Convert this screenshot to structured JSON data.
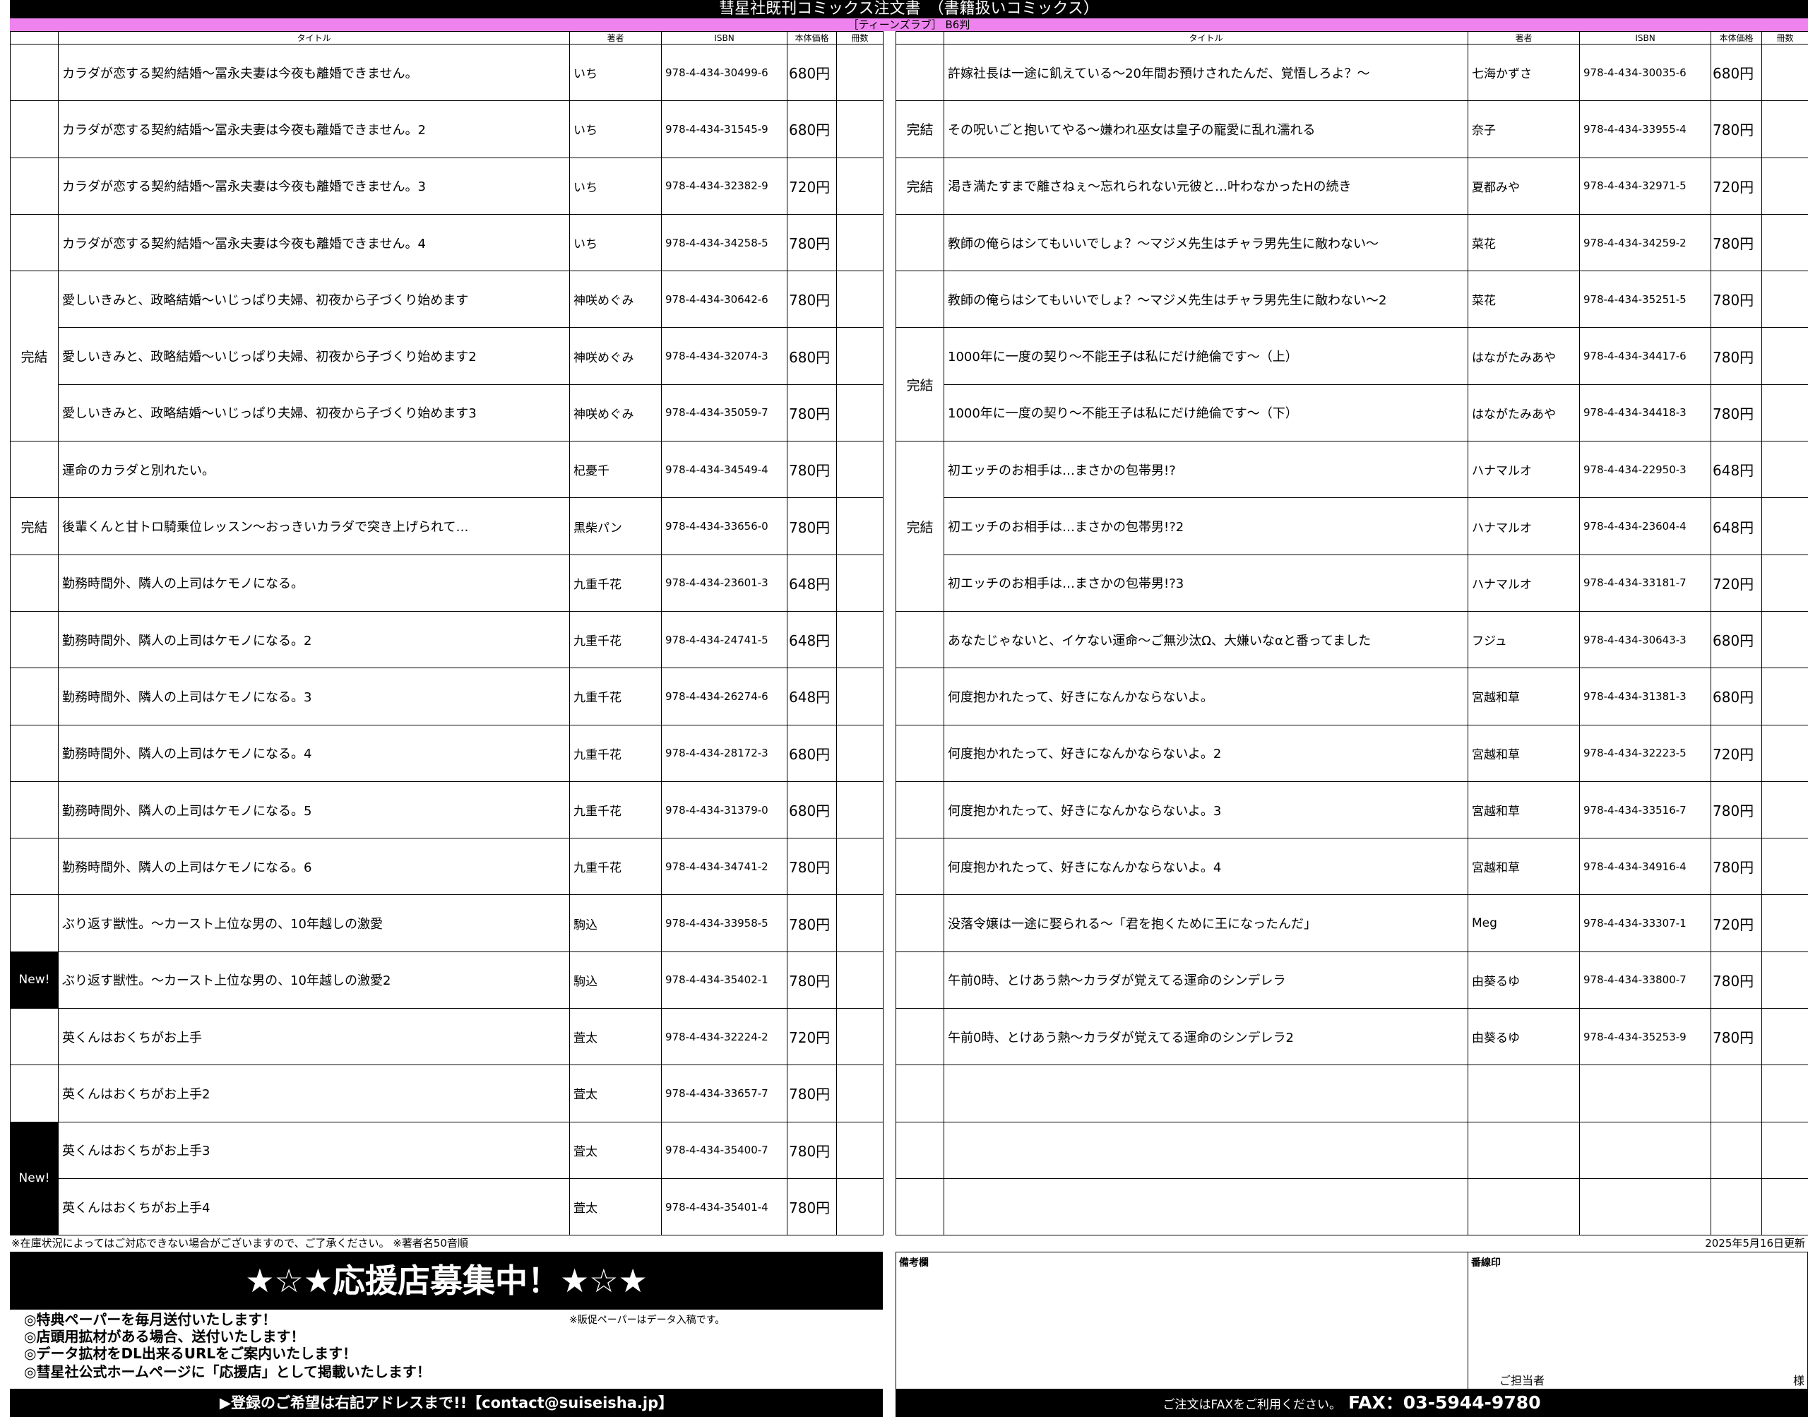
{
  "header": {
    "title": "彗星社既刊コミックス注文書　（書籍扱いコミックス）",
    "subtitle": "［ティーンズラブ］ B6判"
  },
  "table_headers": {
    "status": "",
    "title": "タイトル",
    "author": "著者",
    "isbn": "ISBN",
    "price": "本体価格",
    "qty": "冊数"
  },
  "left_rows": [
    {
      "status": "",
      "title": "カラダが恋する契約結婚～冨永夫妻は今夜も離婚できません。",
      "author": "いち",
      "isbn": "978-4-434-30499-6",
      "price": "680円"
    },
    {
      "status": "",
      "title": "カラダが恋する契約結婚～冨永夫妻は今夜も離婚できません。2",
      "author": "いち",
      "isbn": "978-4-434-31545-9",
      "price": "680円"
    },
    {
      "status": "",
      "title": "カラダが恋する契約結婚～冨永夫妻は今夜も離婚できません。3",
      "author": "いち",
      "isbn": "978-4-434-32382-9",
      "price": "720円"
    },
    {
      "status": "",
      "title": "カラダが恋する契約結婚～冨永夫妻は今夜も離婚できません。4",
      "author": "いち",
      "isbn": "978-4-434-34258-5",
      "price": "780円"
    },
    {
      "status": "完結",
      "status_rows": 3,
      "title": "愛しいきみと、政略結婚～いじっぱり夫婦、初夜から子づくり始めます",
      "author": "神咲めぐみ",
      "isbn": "978-4-434-30642-6",
      "price": "780円"
    },
    {
      "title": "愛しいきみと、政略結婚～いじっぱり夫婦、初夜から子づくり始めます2",
      "author": "神咲めぐみ",
      "isbn": "978-4-434-32074-3",
      "price": "680円"
    },
    {
      "title": "愛しいきみと、政略結婚～いじっぱり夫婦、初夜から子づくり始めます3",
      "author": "神咲めぐみ",
      "isbn": "978-4-434-35059-7",
      "price": "780円"
    },
    {
      "status": "",
      "title": "運命のカラダと別れたい。",
      "author": "杞憂千",
      "isbn": "978-4-434-34549-4",
      "price": "780円"
    },
    {
      "status": "完結",
      "title": "後輩くんと甘トロ騎乗位レッスン～おっきいカラダで突き上げられて…",
      "author": "黒柴パン",
      "isbn": "978-4-434-33656-0",
      "price": "780円"
    },
    {
      "status": "",
      "title": "勤務時間外、隣人の上司はケモノになる。",
      "author": "九重千花",
      "isbn": "978-4-434-23601-3",
      "price": "648円"
    },
    {
      "status": "",
      "title": "勤務時間外、隣人の上司はケモノになる。2",
      "author": "九重千花",
      "isbn": "978-4-434-24741-5",
      "price": "648円"
    },
    {
      "status": "",
      "title": "勤務時間外、隣人の上司はケモノになる。3",
      "author": "九重千花",
      "isbn": "978-4-434-26274-6",
      "price": "648円"
    },
    {
      "status": "",
      "title": "勤務時間外、隣人の上司はケモノになる。4",
      "author": "九重千花",
      "isbn": "978-4-434-28172-3",
      "price": "680円"
    },
    {
      "status": "",
      "title": "勤務時間外、隣人の上司はケモノになる。5",
      "author": "九重千花",
      "isbn": "978-4-434-31379-0",
      "price": "680円"
    },
    {
      "status": "",
      "title": "勤務時間外、隣人の上司はケモノになる。6",
      "author": "九重千花",
      "isbn": "978-4-434-34741-2",
      "price": "780円"
    },
    {
      "status": "",
      "title": "ぶり返す獣性。～カースト上位な男の、10年越しの激愛",
      "author": "駒込",
      "isbn": "978-4-434-33958-5",
      "price": "780円"
    },
    {
      "status": "New!",
      "status_new": true,
      "title": "ぶり返す獣性。～カースト上位な男の、10年越しの激愛2",
      "author": "駒込",
      "isbn": "978-4-434-35402-1",
      "price": "780円"
    },
    {
      "status": "",
      "title": "英くんはおくちがお上手",
      "author": "萓太",
      "isbn": "978-4-434-32224-2",
      "price": "720円"
    },
    {
      "status": "",
      "title": "英くんはおくちがお上手2",
      "author": "萓太",
      "isbn": "978-4-434-33657-7",
      "price": "780円"
    },
    {
      "status": "New!",
      "status_new": true,
      "status_rows": 2,
      "title": "英くんはおくちがお上手3",
      "author": "萓太",
      "isbn": "978-4-434-35400-7",
      "price": "780円"
    },
    {
      "title": "英くんはおくちがお上手4",
      "author": "萓太",
      "isbn": "978-4-434-35401-4",
      "price": "780円"
    }
  ],
  "right_rows": [
    {
      "status": "",
      "title": "許嫁社長は一途に飢えている～20年間お預けされたんだ、覚悟しろよ？～",
      "author": "七海かずさ",
      "isbn": "978-4-434-30035-6",
      "price": "680円"
    },
    {
      "status": "完結",
      "title": "その呪いごと抱いてやる～嫌われ巫女は皇子の寵愛に乱れ濡れる",
      "author": "奈子",
      "isbn": "978-4-434-33955-4",
      "price": "780円"
    },
    {
      "status": "完結",
      "title": "渇き満たすまで離さねぇ～忘れられない元彼と…叶わなかったHの続き",
      "author": "夏都みや",
      "isbn": "978-4-434-32971-5",
      "price": "720円"
    },
    {
      "status": "",
      "title": "教師の俺らはシてもいいでしょ？～マジメ先生はチャラ男先生に敵わない～",
      "author": "菜花",
      "isbn": "978-4-434-34259-2",
      "price": "780円"
    },
    {
      "status": "",
      "title": "教師の俺らはシてもいいでしょ？～マジメ先生はチャラ男先生に敵わない～2",
      "author": "菜花",
      "isbn": "978-4-434-35251-5",
      "price": "780円"
    },
    {
      "status": "完結",
      "status_rows": 2,
      "title": "1000年に一度の契り～不能王子は私にだけ絶倫です～（上）",
      "author": "はながたみあや",
      "isbn": "978-4-434-34417-6",
      "price": "780円"
    },
    {
      "title": "1000年に一度の契り～不能王子は私にだけ絶倫です～（下）",
      "author": "はながたみあや",
      "isbn": "978-4-434-34418-3",
      "price": "780円"
    },
    {
      "status": "完結",
      "status_rows": 3,
      "title": "初エッチのお相手は…まさかの包帯男!?",
      "author": "ハナマルオ",
      "isbn": "978-4-434-22950-3",
      "price": "648円"
    },
    {
      "title": "初エッチのお相手は…まさかの包帯男!?2",
      "author": "ハナマルオ",
      "isbn": "978-4-434-23604-4",
      "price": "648円"
    },
    {
      "title": "初エッチのお相手は…まさかの包帯男!?3",
      "author": "ハナマルオ",
      "isbn": "978-4-434-33181-7",
      "price": "720円"
    },
    {
      "status": "",
      "title": "あなたじゃないと、イケない運命～ご無沙汰Ω、大嫌いなαと番ってました",
      "author": "フジュ",
      "isbn": "978-4-434-30643-3",
      "price": "680円"
    },
    {
      "status": "",
      "title": "何度抱かれたって、好きになんかならないよ。",
      "author": "宮越和草",
      "isbn": "978-4-434-31381-3",
      "price": "680円"
    },
    {
      "status": "",
      "title": "何度抱かれたって、好きになんかならないよ。2",
      "author": "宮越和草",
      "isbn": "978-4-434-32223-5",
      "price": "720円"
    },
    {
      "status": "",
      "title": "何度抱かれたって、好きになんかならないよ。3",
      "author": "宮越和草",
      "isbn": "978-4-434-33516-7",
      "price": "780円"
    },
    {
      "status": "",
      "title": "何度抱かれたって、好きになんかならないよ。4",
      "author": "宮越和草",
      "isbn": "978-4-434-34916-4",
      "price": "780円"
    },
    {
      "status": "",
      "title": "没落令嬢は一途に娶られる～「君を抱くために王になったんだ」",
      "author": "Meg",
      "isbn": "978-4-434-33307-1",
      "price": "720円"
    },
    {
      "status": "",
      "title": "午前0時、とけあう熱～カラダが覚えてる運命のシンデレラ",
      "author": "由葵るゆ",
      "isbn": "978-4-434-33800-7",
      "price": "780円"
    },
    {
      "status": "",
      "title": "午前0時、とけあう熱～カラダが覚えてる運命のシンデレラ2",
      "author": "由葵るゆ",
      "isbn": "978-4-434-35253-9",
      "price": "780円"
    },
    {
      "status": "",
      "title": "",
      "author": "",
      "isbn": "",
      "price": ""
    },
    {
      "status": "",
      "title": "",
      "author": "",
      "isbn": "",
      "price": ""
    },
    {
      "status": "",
      "title": "",
      "author": "",
      "isbn": "",
      "price": ""
    }
  ],
  "footer": {
    "stock_note": "※在庫状況によってはご対応できない場合がございますので、ご了承ください。 ※著者名50音順",
    "updated": "2025年5月16日更新"
  },
  "promo": {
    "heading": "★☆★応援店募集中！★☆★",
    "lines": [
      "◎特典ペーパーを毎月送付いたします！",
      "◎店頭用拡材がある場合、送付いたします！",
      "◎データ拡材をDL出来るURLをご案内いたします！",
      "◎彗星社公式ホームページに「応援店」として掲載いたします！"
    ],
    "note": "※販促ペーパーはデータ入稿です。",
    "footer": "▶登録のご希望は右記アドレスまで!!【contact@suiseisha.jp】"
  },
  "remarks": {
    "label": "備考欄"
  },
  "stamp": {
    "label": "番線印",
    "tantou": "ご担当者",
    "sama": "様"
  },
  "fax": {
    "note": "ご注文はFAXをご利用ください。",
    "number": "FAX：03-5944-9780"
  }
}
